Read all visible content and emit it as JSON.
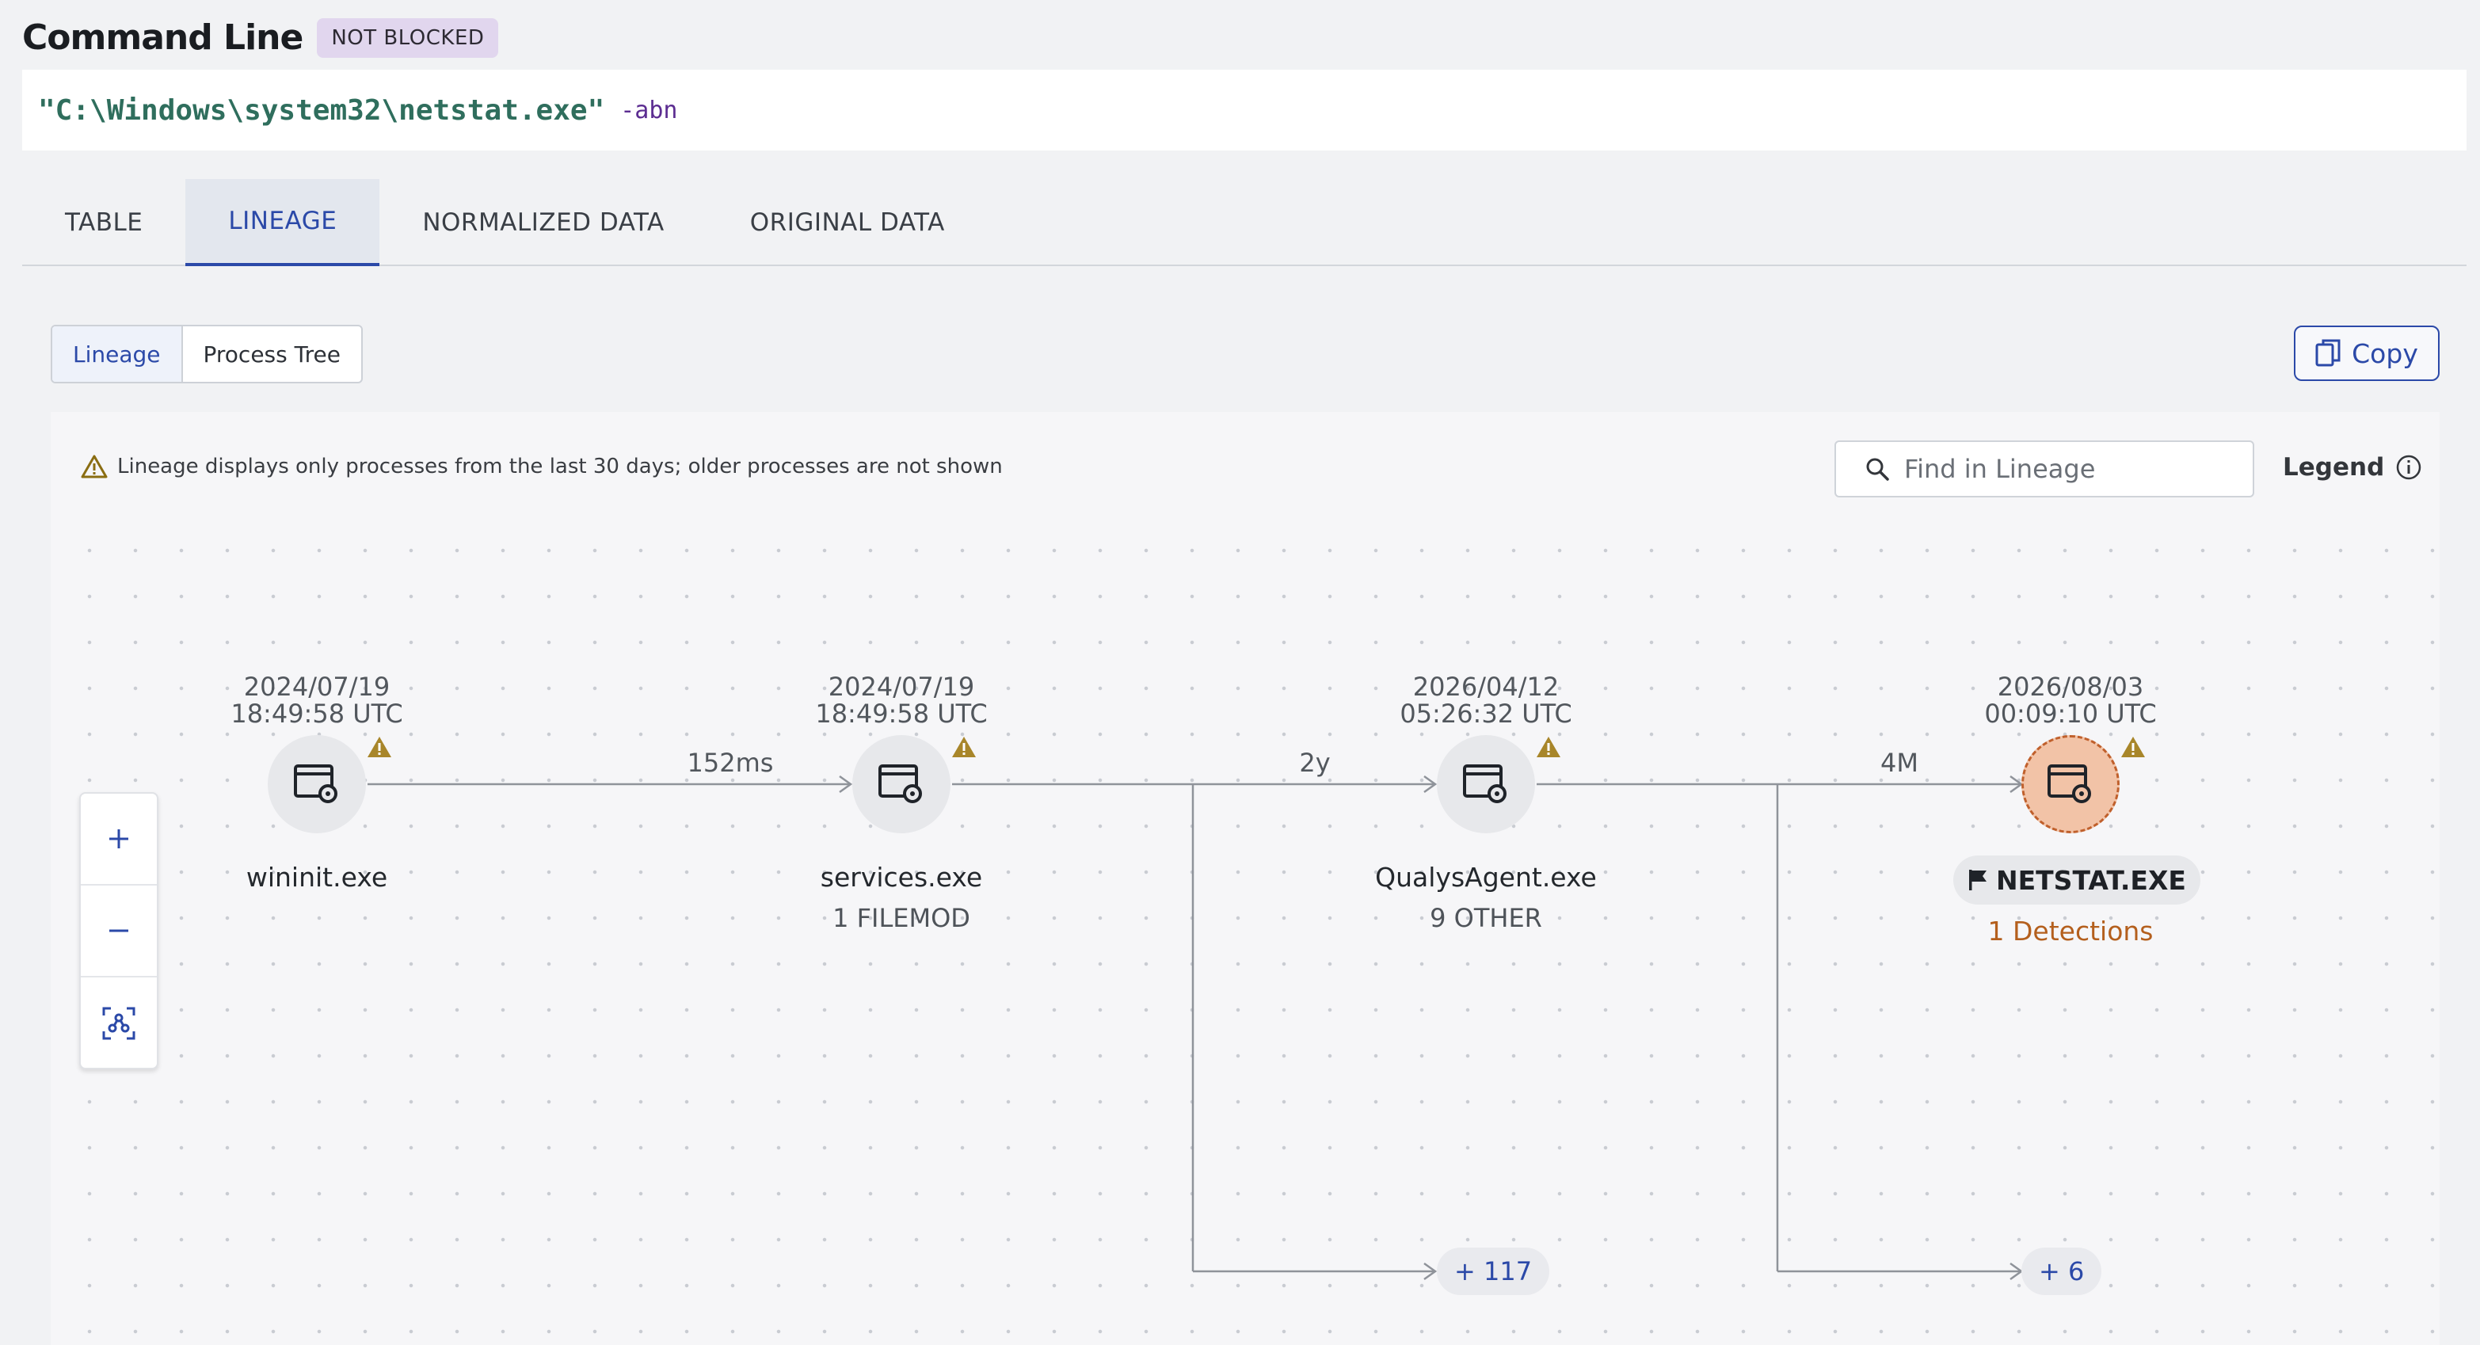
{
  "header": {
    "title": "Command Line",
    "badge": "NOT BLOCKED"
  },
  "command": {
    "executable": "\"C:\\Windows\\system32\\netstat.exe\"",
    "args": "-abn"
  },
  "tabs": [
    {
      "label": "TABLE",
      "active": false
    },
    {
      "label": "LINEAGE",
      "active": true
    },
    {
      "label": "NORMALIZED DATA",
      "active": false
    },
    {
      "label": "ORIGINAL DATA",
      "active": false
    }
  ],
  "view_toggle": {
    "lineage": "Lineage",
    "process_tree": "Process Tree"
  },
  "copy_label": "Copy",
  "notice": "Lineage displays only processes from the last 30 days; older processes are not shown",
  "search": {
    "placeholder": "Find in Lineage"
  },
  "legend_label": "Legend",
  "nodes": [
    {
      "date": "2024/07/19",
      "time": "18:49:58 UTC",
      "name": "wininit.exe",
      "sub": ""
    },
    {
      "date": "2024/07/19",
      "time": "18:49:58 UTC",
      "name": "services.exe",
      "sub": "1 FILEMOD"
    },
    {
      "date": "2026/04/12",
      "time": "05:26:32 UTC",
      "name": "QualysAgent.exe",
      "sub": "9 OTHER"
    },
    {
      "date": "2026/08/03",
      "time": "00:09:10 UTC",
      "name": "NETSTAT.EXE",
      "detections": "1 Detections",
      "flagged": true
    }
  ],
  "edges": [
    "152ms",
    "2y",
    "4M"
  ],
  "more": [
    "+ 117",
    "+ 6"
  ],
  "colors": {
    "accent": "#2b49a8",
    "flagged": "#f2c3a7",
    "detection": "#b45f1d",
    "command": "#2f6e5d"
  }
}
